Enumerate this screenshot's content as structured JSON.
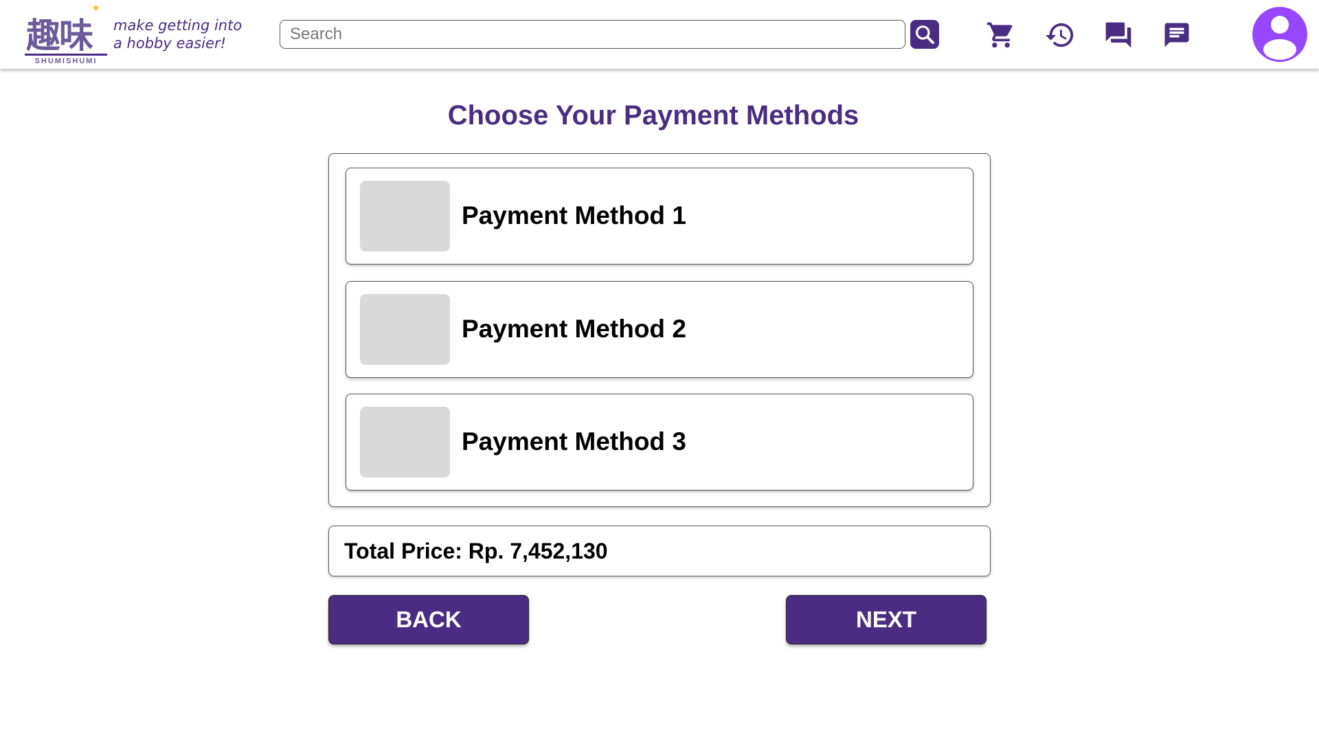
{
  "header": {
    "logo_text": "趣味",
    "logo_subtext": "SHUMISHUMI",
    "tagline_line1": "make getting into",
    "tagline_line2": "a hobby easier!",
    "search_placeholder": "Search",
    "icons": [
      "search-icon",
      "cart-icon",
      "history-icon",
      "chats-icon",
      "message-icon",
      "user-avatar-icon"
    ]
  },
  "page": {
    "title": "Choose Your Payment Methods",
    "payment_methods": [
      {
        "label": "Payment Method 1"
      },
      {
        "label": "Payment Method 2"
      },
      {
        "label": "Payment Method 3"
      }
    ],
    "total_price": "Total Price: Rp. 7,452,130",
    "back_label": "BACK",
    "next_label": "NEXT"
  },
  "colors": {
    "accent": "#4a2d82",
    "avatar": "#9747ff",
    "placeholder": "#d9d9d9"
  }
}
